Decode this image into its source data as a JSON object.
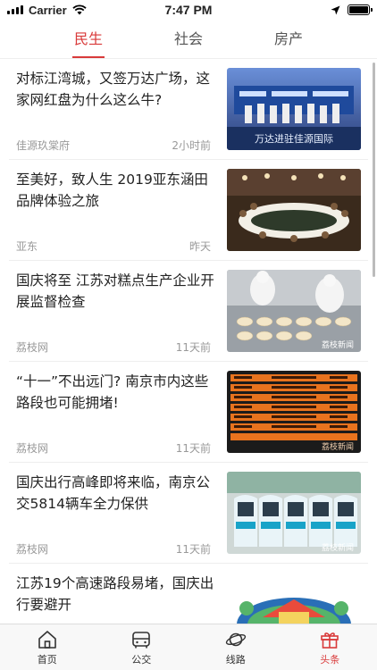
{
  "status_bar": {
    "carrier": "Carrier",
    "time": "7:47 PM"
  },
  "top_tabs": [
    {
      "label": "民生",
      "active": true
    },
    {
      "label": "社会",
      "active": false
    },
    {
      "label": "房产",
      "active": false
    }
  ],
  "news": [
    {
      "title": "对标江湾城，又签万达广场，这家网红盘为什么这么牛?",
      "source": "佳源玖棠府",
      "time": "2小时前",
      "thumb": "stage-event",
      "thumb_text": "万达进驻佳源国际"
    },
    {
      "title": "至美好，致人生 2019亚东涵田品牌体验之旅",
      "source": "亚东",
      "time": "昨天",
      "thumb": "banquet-hall"
    },
    {
      "title": "国庆将至 江苏对糕点生产企业开展监督检查",
      "source": "荔枝网",
      "time": "11天前",
      "thumb": "bakery-inspection",
      "thumb_text": "荔枝新闻"
    },
    {
      "title": "“十一”不出远门? 南京市内这些路段也可能拥堵!",
      "source": "荔枝网",
      "time": "11天前",
      "thumb": "traffic-table",
      "thumb_text": "荔枝新闻"
    },
    {
      "title": "国庆出行高峰即将来临，南京公交5814辆车全力保供",
      "source": "荔枝网",
      "time": "11天前",
      "thumb": "buses",
      "thumb_text": "荔枝新闻"
    },
    {
      "title": "江苏19个高速路段易堵，国庆出行要避开",
      "source": "",
      "time": "",
      "thumb": "map-illustration"
    }
  ],
  "tab_bar": [
    {
      "label": "首页",
      "icon": "home-icon",
      "active": false
    },
    {
      "label": "公交",
      "icon": "bus-icon",
      "active": false
    },
    {
      "label": "线路",
      "icon": "planet-icon",
      "active": false
    },
    {
      "label": "头条",
      "icon": "gift-icon",
      "active": true
    }
  ],
  "colors": {
    "accent": "#d93a3a"
  }
}
